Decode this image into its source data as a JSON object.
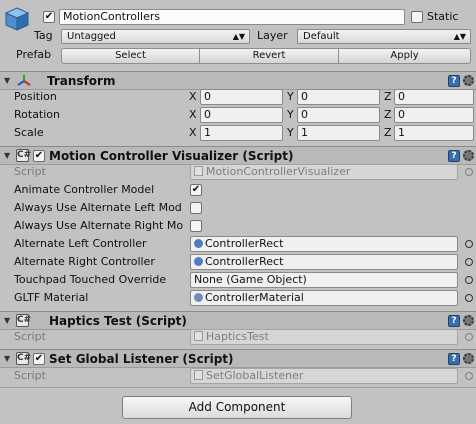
{
  "gameobject": {
    "name": "MotionControllers",
    "active": true,
    "static_label": "Static",
    "tag_label": "Tag",
    "tag_value": "Untagged",
    "layer_label": "Layer",
    "layer_value": "Default",
    "prefab_label": "Prefab",
    "prefab_buttons": [
      "Select",
      "Revert",
      "Apply"
    ]
  },
  "transform": {
    "title": "Transform",
    "rows": [
      {
        "label": "Position",
        "x": "0",
        "y": "0",
        "z": "0"
      },
      {
        "label": "Rotation",
        "x": "0",
        "y": "0",
        "z": "0"
      },
      {
        "label": "Scale",
        "x": "1",
        "y": "1",
        "z": "1"
      }
    ],
    "axis_x": "X",
    "axis_y": "Y",
    "axis_z": "Z"
  },
  "visualizer": {
    "title": "Motion Controller Visualizer (Script)",
    "enabled": true,
    "script_label": "Script",
    "script_value": "MotionControllerVisualizer",
    "animate_label": "Animate Controller Model",
    "animate_checked": true,
    "alt_left_label": "Always Use Alternate Left Mod",
    "alt_left_checked": false,
    "alt_right_label": "Always Use Alternate Right Mo",
    "alt_right_checked": false,
    "alternate_left_controller_label": "Alternate Left Controller",
    "alternate_left_controller_value": "ControllerRect",
    "alternate_right_controller_label": "Alternate Right Controller",
    "alternate_right_controller_value": "ControllerRect",
    "touchpad_label": "Touchpad Touched Override",
    "touchpad_value": "None (Game Object)",
    "gltf_label": "GLTF Material",
    "gltf_value": "ControllerMaterial"
  },
  "haptics": {
    "title": "Haptics Test (Script)",
    "script_label": "Script",
    "script_value": "HapticsTest"
  },
  "listener": {
    "title": "Set Global Listener (Script)",
    "enabled": true,
    "script_label": "Script",
    "script_value": "SetGlobalListener"
  },
  "add_component_label": "Add Component",
  "colors": {
    "background": "#c2c2c2",
    "header": "#b9b9b9",
    "help_icon": "#3a6ea8"
  }
}
